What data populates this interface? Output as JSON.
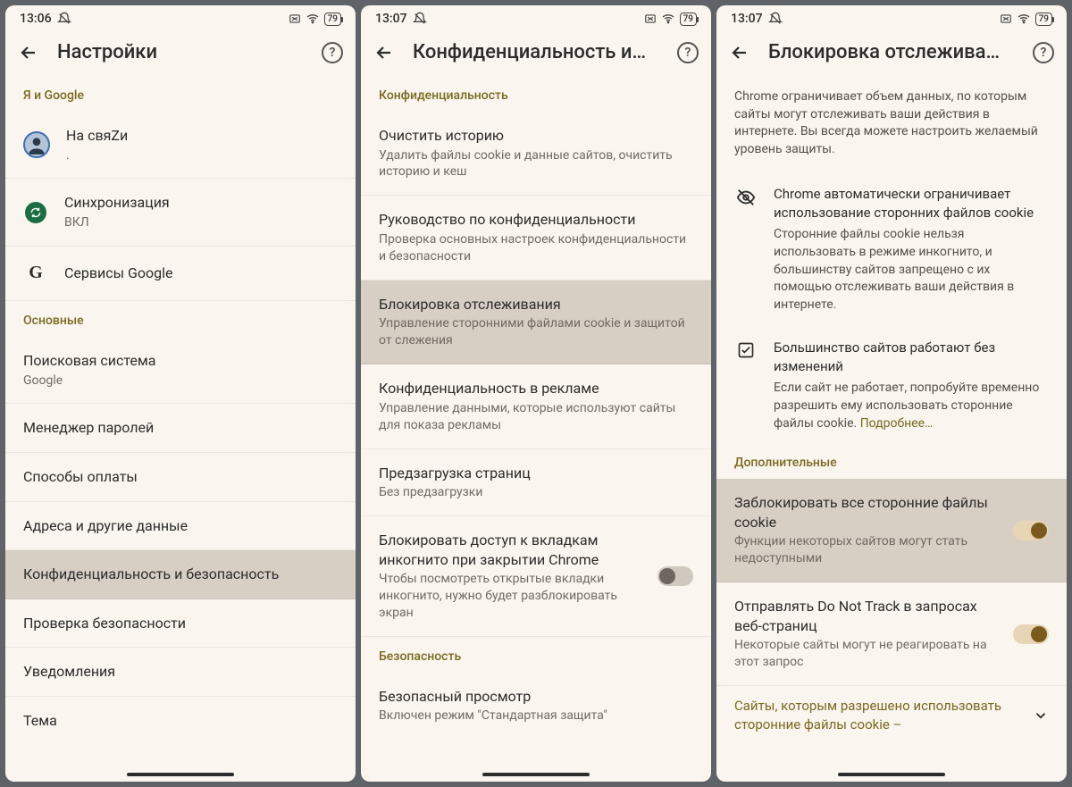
{
  "status": {
    "time1": "13:06",
    "time2": "13:07",
    "time3": "13:07",
    "battery": "79"
  },
  "panel1": {
    "title": "Настройки",
    "sec_me": "Я и Google",
    "account_name": "На свяZи",
    "account_sub": ".",
    "sync_title": "Синхронизация",
    "sync_sub": "ВКЛ",
    "gservices": "Сервисы Google",
    "sec_main": "Основные",
    "search_engine_title": "Поисковая система",
    "search_engine_sub": "Google",
    "pw_mgr": "Менеджер паролей",
    "payments": "Способы оплаты",
    "addresses": "Адреса и другие данные",
    "privacy": "Конфиденциальность и безопасность",
    "safety": "Проверка безопасности",
    "notif": "Уведомления",
    "theme": "Тема"
  },
  "panel2": {
    "title": "Конфиденциальность и…",
    "sec_priv": "Конфиденциальность",
    "clear_title": "Очистить историю",
    "clear_sub": "Удалить файлы cookie и данные сайтов, очистить историю и кеш",
    "guide_title": "Руководство по конфиденциальности",
    "guide_sub": "Проверка основных настроек конфиденциальности и безопасности",
    "track_title": "Блокировка отслеживания",
    "track_sub": "Управление сторонними файлами cookie и защитой от слежения",
    "ads_title": "Конфиденциальность в рекламе",
    "ads_sub": "Управление данными, которые используют сайты для показа рекламы",
    "preload_title": "Предзагрузка страниц",
    "preload_sub": "Без предзагрузки",
    "incog_title": "Блокировать доступ к вкладкам инкогнито при закрытии Chrome",
    "incog_sub": "Чтобы посмотреть открытые вкладки инкогнито, нужно будет разблокировать экран",
    "sec_sec": "Безопасность",
    "safe_title": "Безопасный просмотр",
    "safe_sub": "Включен режим \"Стандартная защита\""
  },
  "panel3": {
    "title": "Блокировка отслежива…",
    "intro": "Chrome ограничивает объем данных, по которым сайты могут отслеживать ваши действия в интернете. Вы всегда можете настроить желаемый уровень защиты.",
    "f1_title": "Chrome автоматически ограничивает использование сторонних файлов cookie",
    "f1_body": "Сторонние файлы cookie нельзя использовать в режиме инкогнито, и большинству сайтов запрещено с их помощью отслеживать ваши действия в интернете.",
    "f2_title": "Большинство сайтов работают без изменений",
    "f2_body_a": "Если сайт не работает, попробуйте временно разрешить ему использовать сторонние файлы cookie. ",
    "f2_link": "Подробнее…",
    "sec_add": "Дополнительные",
    "block_title": "Заблокировать все сторонние файлы cookie",
    "block_sub": "Функции некоторых сайтов могут стать недоступными",
    "dnt_title": "Отправлять Do Not Track в запросах веб-страниц",
    "dnt_sub": "Некоторые сайты могут не реагировать на этот запрос",
    "allowed": "Сайты, которым разрешено использовать сторонние файлы cookie –"
  }
}
